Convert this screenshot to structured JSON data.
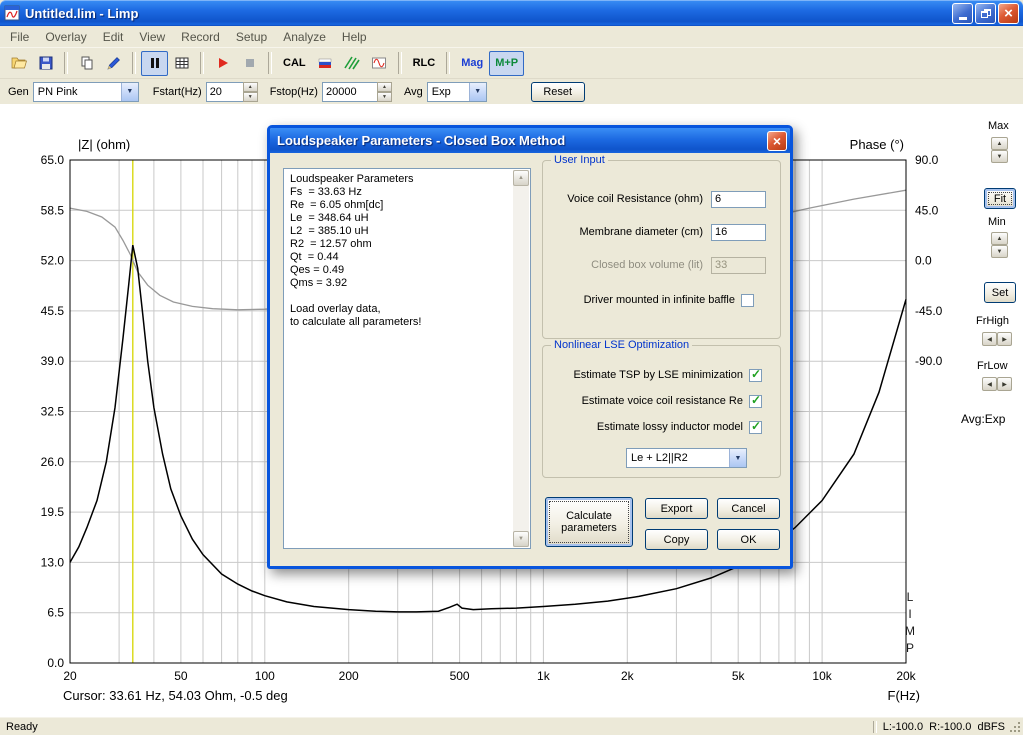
{
  "window": {
    "title": "Untitled.lim - Limp"
  },
  "menu": {
    "items": [
      "File",
      "Overlay",
      "Edit",
      "View",
      "Record",
      "Setup",
      "Analyze",
      "Help"
    ]
  },
  "toolbar": {
    "icons": [
      "open",
      "save",
      "copy",
      "pen",
      "pause",
      "table",
      "record",
      "stop",
      "flag",
      "spectrum",
      "signal"
    ],
    "cal": "CAL",
    "rlc": "RLC",
    "mag": "Mag",
    "mp": "M+P"
  },
  "gen_bar": {
    "gen_label": "Gen",
    "gen_value": "PN Pink",
    "fstart_label": "Fstart(Hz)",
    "fstart_value": "20",
    "fstop_label": "Fstop(Hz)",
    "fstop_value": "20000",
    "avg_label": "Avg",
    "avg_value": "Exp",
    "reset": "Reset"
  },
  "right_panel": {
    "max": "Max",
    "fit": "Fit",
    "min": "Min",
    "set": "Set",
    "frhigh": "FrHigh",
    "frlow": "FrLow",
    "avg_text": "Avg:Exp"
  },
  "dialog": {
    "title": "Loudspeaker Parameters - Closed Box Method",
    "params_text": "Loudspeaker Parameters\nFs  = 33.63 Hz\nRe  = 6.05 ohm[dc]\nLe  = 348.64 uH\nL2  = 385.10 uH\nR2  = 12.57 ohm\nQt  = 0.44\nQes = 0.49\nQms = 3.92\n\nLoad overlay data,\nto calculate all parameters!",
    "user_input": {
      "title": "User Input",
      "fields": [
        {
          "label": "Voice coil Resistance (ohm)",
          "value": "6",
          "enabled": true
        },
        {
          "label": "Membrane diameter (cm)",
          "value": "16",
          "enabled": true
        },
        {
          "label": "Closed box volume (lit)",
          "value": "33",
          "enabled": false
        }
      ],
      "baffle_label": "Driver mounted in infinite baffle",
      "baffle_checked": false
    },
    "lse": {
      "title": "Nonlinear LSE Optimization",
      "options": [
        {
          "label": "Estimate TSP by LSE minimization",
          "checked": true
        },
        {
          "label": "Estimate voice coil resistance Re",
          "checked": true
        },
        {
          "label": "Estimate lossy inductor model",
          "checked": true
        }
      ],
      "inductor_model": "Le + L2||R2"
    },
    "buttons": {
      "calculate": "Calculate parameters",
      "export": "Export",
      "cancel": "Cancel",
      "copy": "Copy",
      "ok": "OK"
    }
  },
  "status": {
    "ready": "Ready",
    "levels": "L:-100.0  R:-100.0  dBFS"
  },
  "chart_data": {
    "type": "line",
    "x_axis": {
      "label": "F(Hz)",
      "scale": "log",
      "min": 20,
      "max": 20000,
      "tick_labels": [
        "20",
        "50",
        "100",
        "200",
        "500",
        "1k",
        "2k",
        "5k",
        "10k",
        "20k"
      ],
      "tick_values": [
        20,
        50,
        100,
        200,
        500,
        1000,
        2000,
        5000,
        10000,
        20000
      ]
    },
    "y_left": {
      "label": "|Z| (ohm)",
      "min": 0,
      "max": 65,
      "ticks": [
        "65.0",
        "58.5",
        "52.0",
        "45.5",
        "39.0",
        "32.5",
        "26.0",
        "19.5",
        "13.0",
        "6.5",
        "0.0"
      ]
    },
    "y_right": {
      "label": "Phase (°)",
      "ticks": [
        "90.0",
        "45.0",
        "0.0",
        "-45.0",
        "-90.0"
      ],
      "zero_deg_at_left_value": 52,
      "left_units_per_45deg": 6.5
    },
    "grid": true,
    "legend": false,
    "series": [
      {
        "name": "impedance",
        "color": "#000000",
        "axis": "left",
        "points": [
          [
            20,
            13
          ],
          [
            21.5,
            15
          ],
          [
            23,
            17.5
          ],
          [
            25,
            21
          ],
          [
            27,
            26
          ],
          [
            29,
            33
          ],
          [
            31,
            42
          ],
          [
            32.5,
            49
          ],
          [
            33.6,
            54
          ],
          [
            35,
            51
          ],
          [
            36.5,
            45
          ],
          [
            38,
            39
          ],
          [
            40,
            33
          ],
          [
            43,
            27
          ],
          [
            46,
            22.5
          ],
          [
            50,
            19
          ],
          [
            55,
            16
          ],
          [
            60,
            14
          ],
          [
            70,
            11.5
          ],
          [
            80,
            10.2
          ],
          [
            90,
            9.3
          ],
          [
            100,
            8.7
          ],
          [
            120,
            7.9
          ],
          [
            150,
            7.3
          ],
          [
            200,
            6.9
          ],
          [
            250,
            6.7
          ],
          [
            300,
            6.6
          ],
          [
            350,
            6.6
          ],
          [
            420,
            6.7
          ],
          [
            460,
            7.2
          ],
          [
            490,
            7.6
          ],
          [
            510,
            7.1
          ],
          [
            560,
            6.9
          ],
          [
            650,
            7.0
          ],
          [
            800,
            7.1
          ],
          [
            1000,
            7.3
          ],
          [
            1300,
            7.6
          ],
          [
            1700,
            8.0
          ],
          [
            2200,
            8.6
          ],
          [
            3000,
            9.6
          ],
          [
            4000,
            11.0
          ],
          [
            5000,
            12.5
          ],
          [
            6500,
            15.0
          ],
          [
            8000,
            17.5
          ],
          [
            10000,
            21.0
          ],
          [
            13000,
            27.0
          ],
          [
            16000,
            35.0
          ],
          [
            20000,
            47.0
          ]
        ]
      },
      {
        "name": "phase",
        "color": "#999999",
        "axis": "right",
        "points": [
          [
            20,
            47
          ],
          [
            23,
            44
          ],
          [
            26,
            39
          ],
          [
            29,
            30
          ],
          [
            31,
            18
          ],
          [
            33,
            5
          ],
          [
            33.6,
            0
          ],
          [
            35,
            -10
          ],
          [
            38,
            -22
          ],
          [
            42,
            -31
          ],
          [
            47,
            -37
          ],
          [
            55,
            -41
          ],
          [
            65,
            -43
          ],
          [
            80,
            -44
          ],
          [
            100,
            -43.5
          ],
          [
            130,
            -42
          ],
          [
            170,
            -39
          ],
          [
            220,
            -35
          ],
          [
            300,
            -29
          ],
          [
            400,
            -23
          ],
          [
            550,
            -17
          ],
          [
            750,
            -10
          ],
          [
            1000,
            -4
          ],
          [
            1400,
            3
          ],
          [
            2000,
            11
          ],
          [
            3000,
            21
          ],
          [
            4500,
            30
          ],
          [
            6500,
            39
          ],
          [
            9000,
            47
          ],
          [
            13000,
            55
          ],
          [
            20000,
            63
          ]
        ]
      }
    ],
    "cursor": {
      "frequency_hz": 33.61,
      "label": "Cursor: 33.61 Hz, 54.03 Ohm, -0.5 deg",
      "color": "#d6d600"
    },
    "watermark": [
      "L",
      "I",
      "M",
      "P"
    ]
  }
}
